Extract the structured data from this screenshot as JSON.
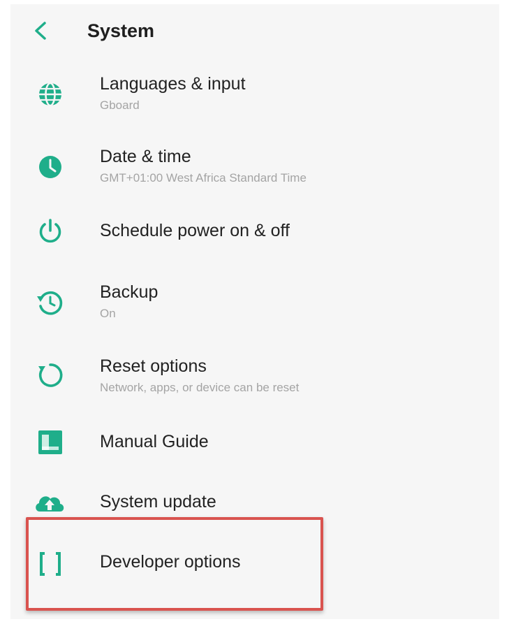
{
  "header": {
    "title": "System",
    "back_icon": "chevron-left-icon"
  },
  "colors": {
    "accent": "#1fae8a",
    "highlight": "#d9534f",
    "background": "#f6f6f6"
  },
  "items": [
    {
      "label": "Languages & input",
      "sub": "Gboard",
      "icon": "globe-icon"
    },
    {
      "label": "Date & time",
      "sub": "GMT+01:00 West Africa Standard Time",
      "icon": "clock-icon"
    },
    {
      "label": "Schedule power on & off",
      "sub": "",
      "icon": "power-icon"
    },
    {
      "label": "Backup",
      "sub": "On",
      "icon": "backup-icon"
    },
    {
      "label": "Reset options",
      "sub": "Network, apps, or device can be reset",
      "icon": "reset-icon"
    },
    {
      "label": "Manual Guide",
      "sub": "",
      "icon": "book-icon"
    },
    {
      "label": "System update",
      "sub": "",
      "icon": "cloud-upload-icon"
    },
    {
      "label": "Developer options",
      "sub": "",
      "icon": "braces-icon"
    }
  ]
}
